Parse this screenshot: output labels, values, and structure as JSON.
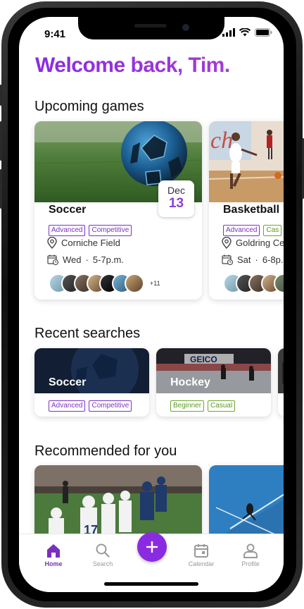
{
  "status": {
    "time": "9:41"
  },
  "header": {
    "welcome": "Welcome back, Tim."
  },
  "sections": {
    "upcoming": "Upcoming games",
    "recent": "Recent searches",
    "recommended": "Recommended for you"
  },
  "upcoming_games": [
    {
      "title": "Soccer",
      "tags": [
        "Advanced",
        "Competitive"
      ],
      "location": "Corniche Field",
      "day": "Wed",
      "time": "5-7p.m.",
      "date_month": "Dec",
      "date_day": "13",
      "extra_players": "+11"
    },
    {
      "title": "Basketball",
      "tags": [
        "Advanced",
        "Cas"
      ],
      "location": "Goldring Ce",
      "day": "Sat",
      "time": "6-8p."
    }
  ],
  "recent_searches": [
    {
      "title": "Soccer",
      "tags": [
        "Advanced",
        "Competitive"
      ]
    },
    {
      "title": "Hockey",
      "tags": [
        "Beginner",
        "Casual"
      ]
    }
  ],
  "tabs": [
    {
      "label": "Home"
    },
    {
      "label": "Search"
    },
    {
      "label": "Calendar"
    },
    {
      "label": "Profile"
    }
  ],
  "colors": {
    "accent": "#8a2be2",
    "tag_purple": "#7b32c7",
    "tag_green": "#5a9a1e"
  }
}
